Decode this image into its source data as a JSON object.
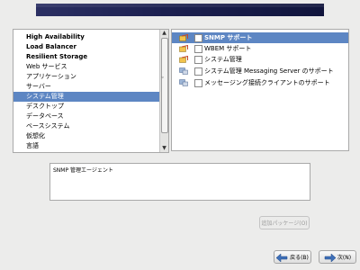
{
  "left_list": {
    "items": [
      {
        "label": "High Availability",
        "bold": true,
        "selected": false
      },
      {
        "label": "Load Balancer",
        "bold": true,
        "selected": false
      },
      {
        "label": "Resilient Storage",
        "bold": true,
        "selected": false
      },
      {
        "label": "Web サービス",
        "bold": false,
        "selected": false
      },
      {
        "label": "アプリケーション",
        "bold": false,
        "selected": false
      },
      {
        "label": "サーバー",
        "bold": false,
        "selected": false
      },
      {
        "label": "システム管理",
        "bold": false,
        "selected": true
      },
      {
        "label": "デスクトップ",
        "bold": false,
        "selected": false
      },
      {
        "label": "データベース",
        "bold": false,
        "selected": false
      },
      {
        "label": "ベースシステム",
        "bold": false,
        "selected": false
      },
      {
        "label": "仮想化",
        "bold": false,
        "selected": false
      },
      {
        "label": "言語",
        "bold": false,
        "selected": false
      }
    ]
  },
  "right_list": {
    "items": [
      {
        "label": "SNMP サポート",
        "bold": true,
        "selected": true,
        "icon": "snmp-package-icon"
      },
      {
        "label": "WBEM サポート",
        "bold": false,
        "selected": false,
        "icon": "wbem-package-icon"
      },
      {
        "label": "システム管理",
        "bold": false,
        "selected": false,
        "icon": "system-management-package-icon"
      },
      {
        "label": "システム管理 Messaging Server のサポート",
        "bold": false,
        "selected": false,
        "icon": "messaging-server-package-icon"
      },
      {
        "label": "メッセージング接続クライアントのサポート",
        "bold": false,
        "selected": false,
        "icon": "messaging-client-package-icon"
      }
    ]
  },
  "description": "SNMP 管理エージェント",
  "buttons": {
    "optional_packages": "追加パッケージ(O)",
    "back": "戻る(B)",
    "next": "次(N)"
  },
  "colors": {
    "selection": "#5d86c3",
    "banner": "#1c2050"
  }
}
